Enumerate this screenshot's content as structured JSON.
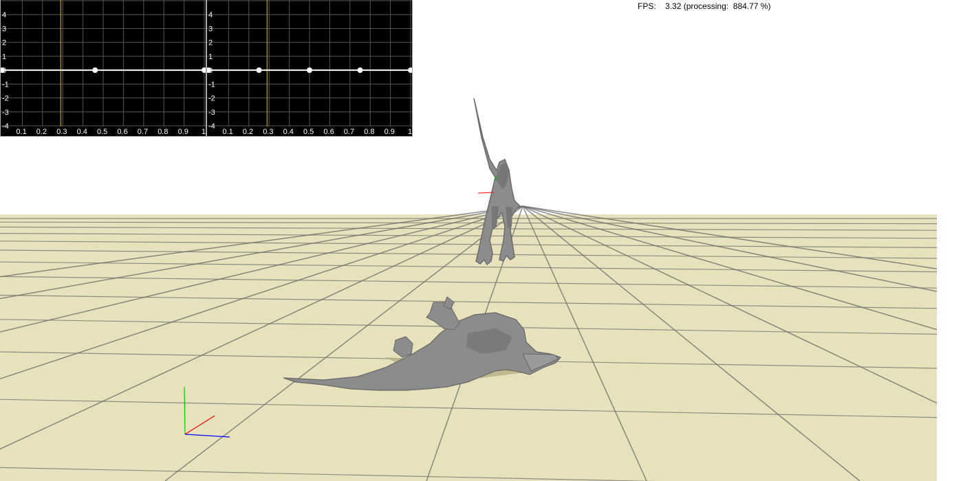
{
  "hud": {
    "fps_label": "FPS:",
    "fps_value": "3.32",
    "processing_label": "(processing:",
    "processing_value": "884.77 %)"
  },
  "graphs": [
    {
      "name": "curve-graph-left",
      "x_ticks": [
        "0.1",
        "0.2",
        "0.3",
        "0.4",
        "0.5",
        "0.6",
        "0.7",
        "0.8",
        "0.9",
        "1"
      ],
      "y_ticks": [
        "4",
        "3",
        "2",
        "1",
        "0",
        "-1",
        "-2",
        "-3",
        "-4"
      ],
      "xlim": [
        0,
        1
      ],
      "ylim": [
        -4,
        5
      ],
      "cursor_x": 0.29,
      "keyframes": [
        0.0,
        0.46,
        1.0
      ]
    },
    {
      "name": "curve-graph-right",
      "x_ticks": [
        "0.1",
        "0.2",
        "0.3",
        "0.4",
        "0.5",
        "0.6",
        "0.7",
        "0.8",
        "0.9",
        "1"
      ],
      "y_ticks": [
        "4",
        "3",
        "2",
        "1",
        "0",
        "-1",
        "-2",
        "-3",
        "-4"
      ],
      "xlim": [
        0,
        1
      ],
      "ylim": [
        -4,
        5
      ],
      "cursor_x": 0.29,
      "keyframes": [
        0.0,
        0.25,
        0.5,
        0.75,
        1.0
      ]
    }
  ],
  "colors": {
    "ground": "#e8e2bc",
    "grid_line": "#6e6e6e",
    "model": "#8c8c8c",
    "model_shade": "#6a6a6a",
    "axis_x": "#ff0000",
    "axis_y": "#00cc00",
    "axis_z": "#0000ff",
    "graph_bg": "#000000",
    "graph_grid": "#555555",
    "graph_cursor": "#b3a026",
    "graph_curve": "#ffffff"
  }
}
